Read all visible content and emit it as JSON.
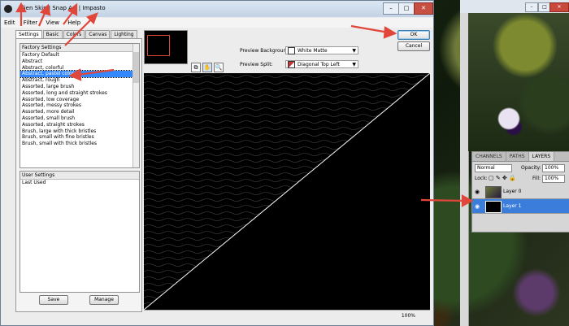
{
  "dialog": {
    "title": "Alien Skin | Snap Art | Impasto",
    "menu": [
      "Edit",
      "Filter",
      "View",
      "Help"
    ],
    "tabs": [
      "Settings",
      "Basic",
      "Colors",
      "Canvas",
      "Lighting"
    ],
    "active_tab": "Settings",
    "settings_header": "Factory Settings",
    "settings_items": [
      "Factory Default",
      "Abstract",
      "Abstract, colorful",
      "Abstract, pastel colors",
      "Abstract, rough",
      "Assorted, large brush",
      "Assorted, long and straight strokes",
      "Assorted, low coverage",
      "Assorted, messy strokes",
      "Assorted, more detail",
      "Assorted, small brush",
      "Assorted, straight strokes",
      "Brush, large with thick bristles",
      "Brush, small with fine bristles",
      "Brush, small with thick bristles"
    ],
    "selected_item": "Abstract, pastel colors",
    "user_settings_header": "User Settings",
    "user_items": [
      "Last Used"
    ],
    "save_label": "Save",
    "manage_label": "Manage",
    "preview_background_label": "Preview Background:",
    "preview_background_value": "White Matte",
    "preview_split_label": "Preview Split:",
    "preview_split_value": "Diagonal Top Left",
    "ok_label": "OK",
    "cancel_label": "Cancel",
    "zoom": "100%",
    "accent": "#e0463a"
  },
  "photoshop": {
    "panel_tabs": [
      "CHANNELS",
      "PATHS",
      "LAYERS"
    ],
    "active_panel_tab": "LAYERS",
    "blend_mode": "Normal",
    "opacity_label": "Opacity:",
    "opacity_value": "100%",
    "lock_label": "Lock:",
    "fill_label": "Fill:",
    "fill_value": "100%",
    "layers": [
      {
        "name": "Layer 0",
        "selected": false
      },
      {
        "name": "Layer 1",
        "selected": true
      }
    ],
    "selection_color": "#3b7ddb"
  }
}
